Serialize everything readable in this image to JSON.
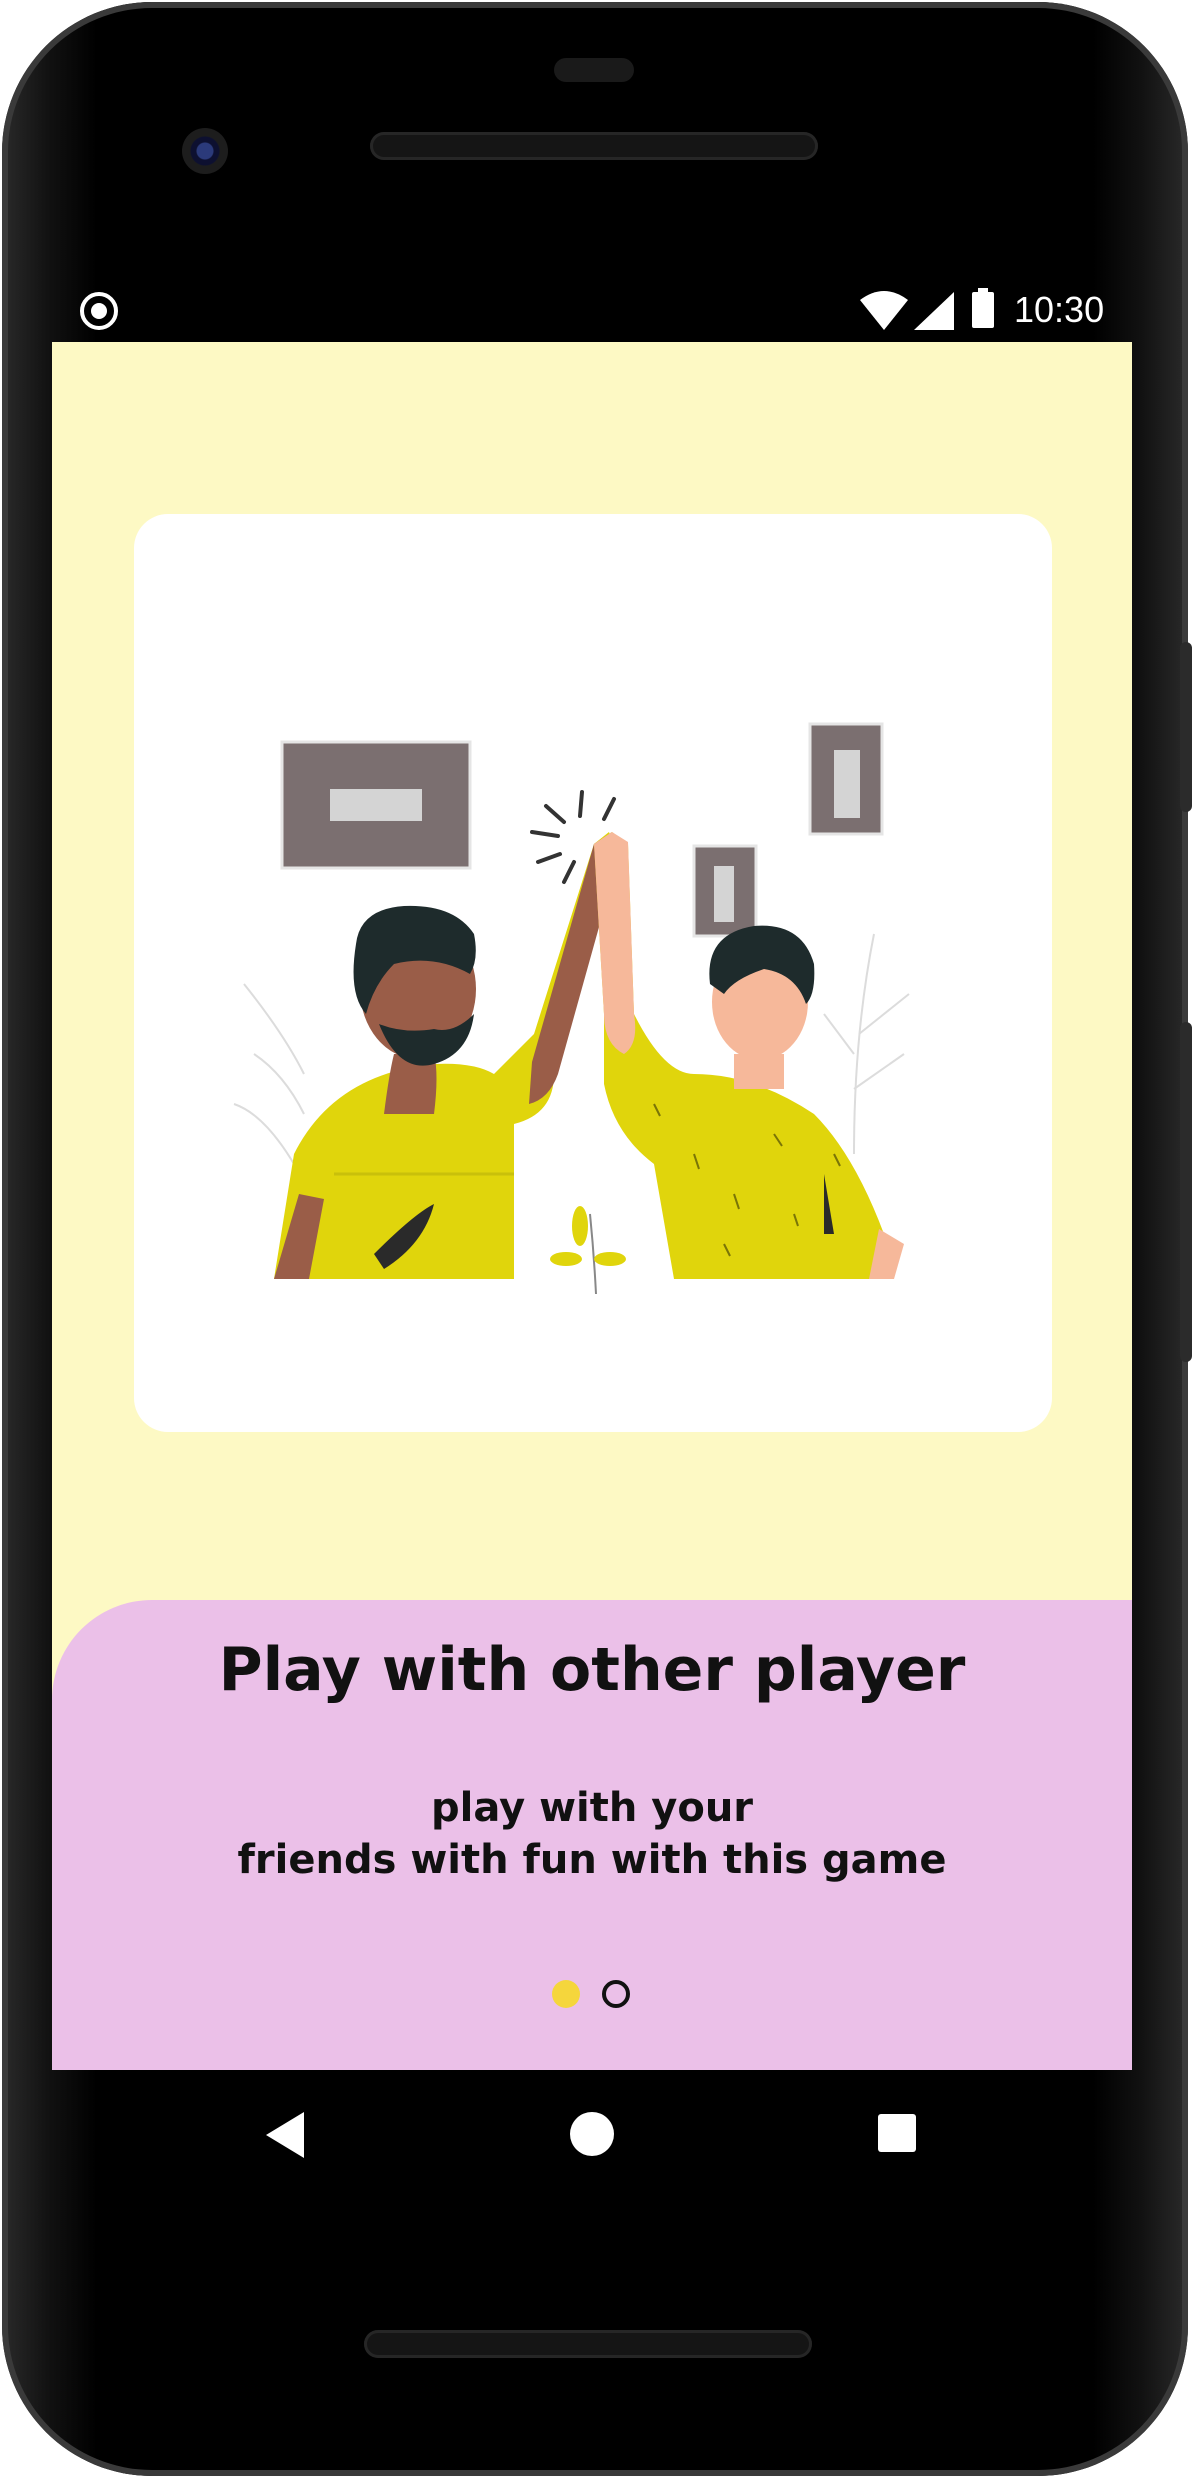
{
  "status_bar": {
    "time": "10:30",
    "icons": [
      "record-indicator-icon",
      "wifi-icon",
      "signal-icon",
      "battery-icon"
    ]
  },
  "onboarding": {
    "title": "Play with other player",
    "subtitle_line1": "play with your",
    "subtitle_line2": "friends with fun with this game",
    "page_indicator": {
      "total": 2,
      "current": 1
    }
  },
  "colors": {
    "screen_background": "#fdf9c4",
    "card_background": "#ffffff",
    "panel_background": "#ebc0e8",
    "active_dot": "#f5d63c",
    "shirt": "#e0d50c"
  },
  "navigation": {
    "buttons": [
      "back-icon",
      "home-icon",
      "recents-icon"
    ]
  }
}
